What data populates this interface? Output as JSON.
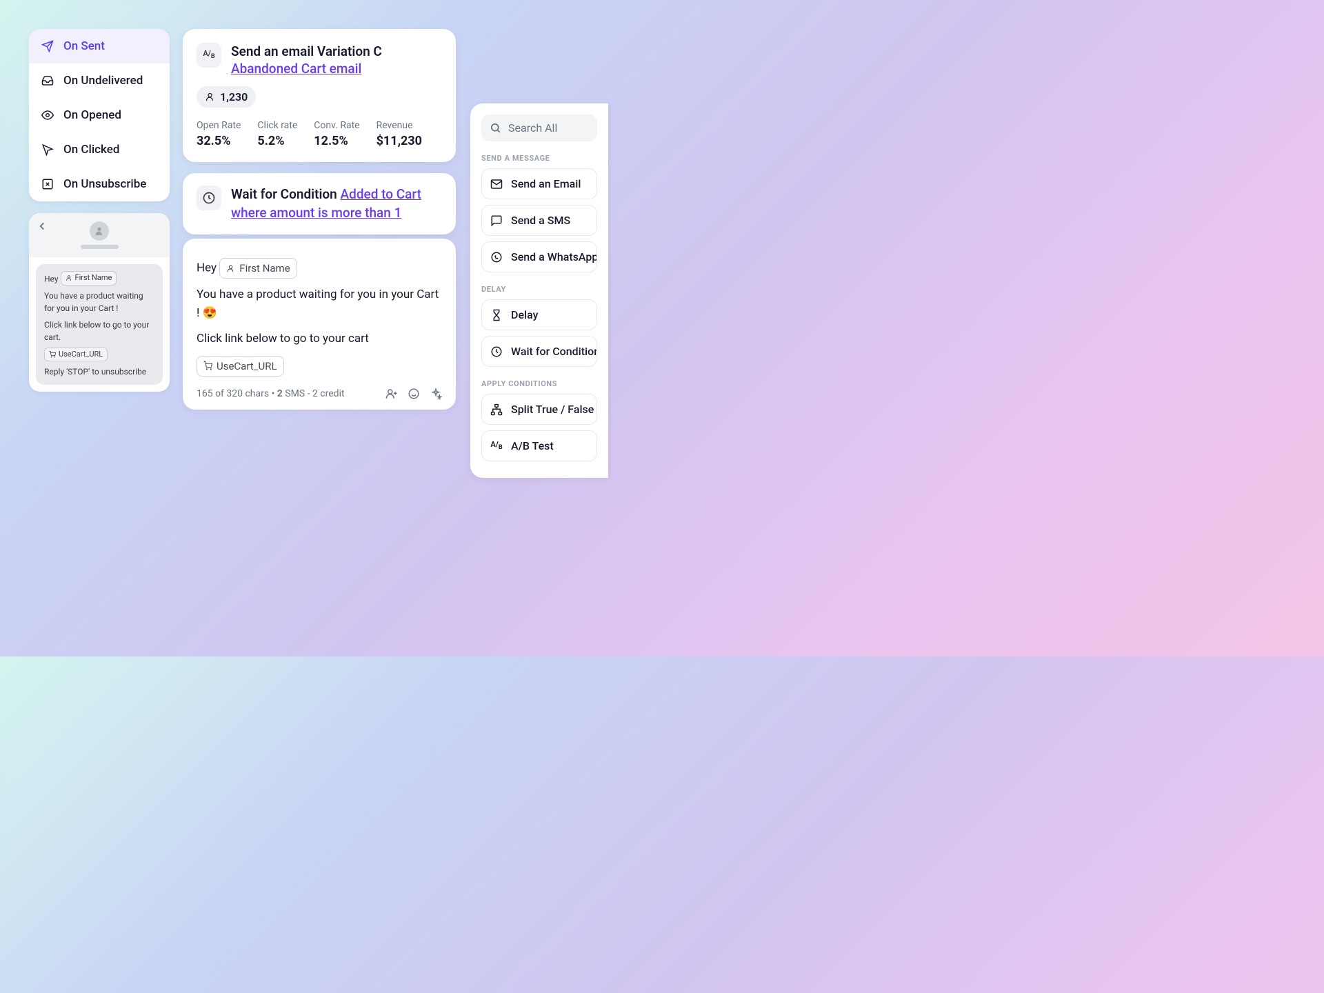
{
  "sidebar": {
    "items": [
      {
        "label": "On Sent",
        "icon": "send-icon",
        "active": true
      },
      {
        "label": "On Undelivered",
        "icon": "inbox-icon",
        "active": false
      },
      {
        "label": "On Opened",
        "icon": "eye-icon",
        "active": false
      },
      {
        "label": "On Clicked",
        "icon": "cursor-icon",
        "active": false
      },
      {
        "label": "On Unsubscribe",
        "icon": "x-square-icon",
        "active": false
      }
    ]
  },
  "sms_preview": {
    "greeting": "Hey",
    "token_first_name": "First Name",
    "line1": "You have a product waiting for you in your Cart !",
    "line2": "Click link below to go to your cart.",
    "token_cart_url": "UseCart_URL",
    "unsubscribe": "Reply 'STOP' to unsubscribe"
  },
  "email_card": {
    "title": "Send an email Variation C",
    "link": "Abandoned Cart email",
    "recipients": "1,230",
    "metrics": [
      {
        "label": "Open Rate",
        "value": "32.5%"
      },
      {
        "label": "Click rate",
        "value": "5.2%"
      },
      {
        "label": "Conv. Rate",
        "value": "12.5%"
      },
      {
        "label": "Revenue",
        "value": "$11,230"
      }
    ]
  },
  "wait_card": {
    "prefix": "Wait for Condition ",
    "link": "Added to Cart where amount is more than 1"
  },
  "composer": {
    "greeting": "Hey",
    "token_first_name": "First Name",
    "line1": "You have a product waiting for you in your Cart ! 😍",
    "line2": "Click link below to go to your cart",
    "token_cart_url": "UseCart_URL",
    "footer_chars": "165 of 320 chars",
    "footer_sms_count": "2",
    "footer_sms_suffix": " SMS - 2 credit"
  },
  "right_panel": {
    "search_placeholder": "Search All",
    "sections": {
      "send": {
        "label": "SEND A MESSAGE",
        "items": [
          {
            "label": "Send an Email",
            "icon": "mail-icon"
          },
          {
            "label": "Send a SMS",
            "icon": "message-icon"
          },
          {
            "label": "Send a WhatsApp",
            "icon": "whatsapp-icon"
          }
        ]
      },
      "delay": {
        "label": "DELAY",
        "items": [
          {
            "label": "Delay",
            "icon": "hourglass-icon"
          },
          {
            "label": "Wait for Condition",
            "icon": "clock-icon"
          }
        ]
      },
      "conditions": {
        "label": "APPLY CONDITIONS",
        "items": [
          {
            "label": "Split True / False",
            "icon": "split-icon"
          },
          {
            "label": "A/B Test",
            "icon": "ab-icon"
          }
        ]
      }
    }
  }
}
